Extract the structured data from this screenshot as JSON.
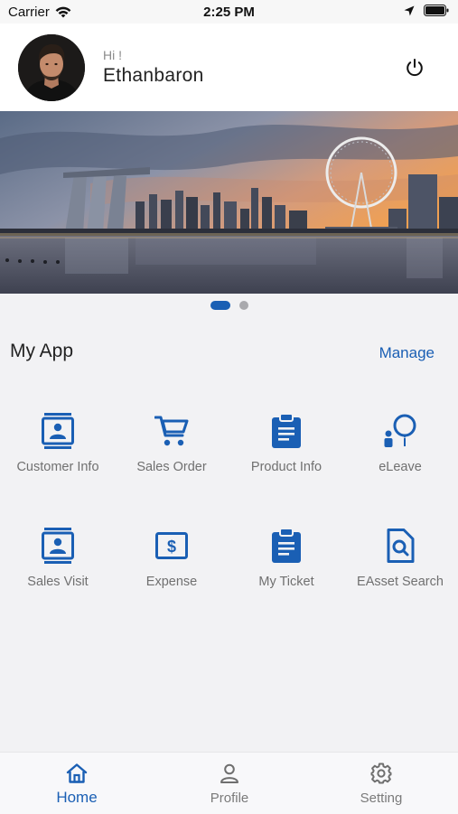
{
  "status_bar": {
    "carrier": "Carrier",
    "time": "2:25 PM"
  },
  "header": {
    "greeting": "Hi !",
    "username": "Ethanbaron"
  },
  "banner": {
    "slides": 2,
    "active_slide": 1
  },
  "section": {
    "title": "My App",
    "manage_label": "Manage"
  },
  "apps": [
    {
      "label": "Customer Info",
      "icon": "contact-card-icon"
    },
    {
      "label": "Sales Order",
      "icon": "shopping-cart-icon"
    },
    {
      "label": "Product Info",
      "icon": "clipboard-icon"
    },
    {
      "label": "eLeave",
      "icon": "person-balloon-icon"
    },
    {
      "label": "Sales Visit",
      "icon": "contact-card-icon"
    },
    {
      "label": "Expense",
      "icon": "dollar-bill-icon"
    },
    {
      "label": "My Ticket",
      "icon": "clipboard-icon"
    },
    {
      "label": "EAsset Search",
      "icon": "document-search-icon"
    }
  ],
  "tab_bar": {
    "tabs": [
      {
        "label": "Home",
        "icon": "home-icon",
        "active": true
      },
      {
        "label": "Profile",
        "icon": "person-icon",
        "active": false
      },
      {
        "label": "Setting",
        "icon": "gear-icon",
        "active": false
      }
    ]
  },
  "colors": {
    "accent": "#1a5fb4",
    "background": "#f2f2f4",
    "label_gray": "#707070"
  }
}
